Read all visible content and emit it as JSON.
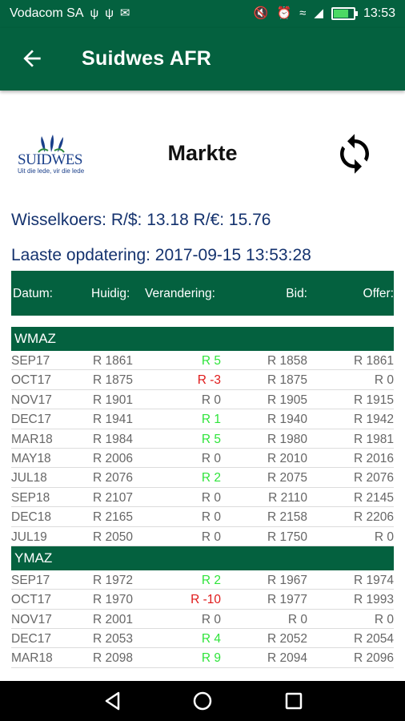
{
  "status_bar": {
    "carrier": "Vodacom SA",
    "time": "13:53",
    "battery_pct": 80
  },
  "app_bar": {
    "title": "Suidwes AFR"
  },
  "header": {
    "logo_text": "SUIDWES",
    "logo_tagline": "Uit die lede, vir die lede",
    "title": "Markte"
  },
  "exchange": "Wisselkoers: R/$: 13.18 R/€: 15.76",
  "last_update": "Laaste opdatering: 2017-09-15 13:53:28",
  "columns": {
    "date": "Datum:",
    "current": "Huidig:",
    "change": "Verandering:",
    "bid": "Bid:",
    "offer": "Offer:"
  },
  "sections": [
    {
      "name": "WMAZ",
      "rows": [
        {
          "date": "SEP17",
          "current": "R 1861",
          "change": "R 5",
          "trend": "pos",
          "bid": "R 1858",
          "offer": "R 1861"
        },
        {
          "date": "OCT17",
          "current": "R 1875",
          "change": "R -3",
          "trend": "neg",
          "bid": "R 1875",
          "offer": "R 0"
        },
        {
          "date": "NOV17",
          "current": "R 1901",
          "change": "R 0",
          "trend": "zero",
          "bid": "R 1905",
          "offer": "R 1915"
        },
        {
          "date": "DEC17",
          "current": "R 1941",
          "change": "R 1",
          "trend": "pos",
          "bid": "R 1940",
          "offer": "R 1942"
        },
        {
          "date": "MAR18",
          "current": "R 1984",
          "change": "R 5",
          "trend": "pos",
          "bid": "R 1980",
          "offer": "R 1981"
        },
        {
          "date": "MAY18",
          "current": "R 2006",
          "change": "R 0",
          "trend": "zero",
          "bid": "R 2010",
          "offer": "R 2016"
        },
        {
          "date": "JUL18",
          "current": "R 2076",
          "change": "R 2",
          "trend": "pos",
          "bid": "R 2075",
          "offer": "R 2076"
        },
        {
          "date": "SEP18",
          "current": "R 2107",
          "change": "R 0",
          "trend": "zero",
          "bid": "R 2110",
          "offer": "R 2145"
        },
        {
          "date": "DEC18",
          "current": "R 2165",
          "change": "R 0",
          "trend": "zero",
          "bid": "R 2158",
          "offer": "R 2206"
        },
        {
          "date": "JUL19",
          "current": "R 2050",
          "change": "R 0",
          "trend": "zero",
          "bid": "R 1750",
          "offer": "R 0"
        }
      ]
    },
    {
      "name": "YMAZ",
      "rows": [
        {
          "date": "SEP17",
          "current": "R 1972",
          "change": "R 2",
          "trend": "pos",
          "bid": "R 1967",
          "offer": "R 1974"
        },
        {
          "date": "OCT17",
          "current": "R 1970",
          "change": "R -10",
          "trend": "neg",
          "bid": "R 1977",
          "offer": "R 1993"
        },
        {
          "date": "NOV17",
          "current": "R 2001",
          "change": "R 0",
          "trend": "zero",
          "bid": "R 0",
          "offer": "R 0"
        },
        {
          "date": "DEC17",
          "current": "R 2053",
          "change": "R 4",
          "trend": "pos",
          "bid": "R 2052",
          "offer": "R 2054"
        },
        {
          "date": "MAR18",
          "current": "R 2098",
          "change": "R 9",
          "trend": "pos",
          "bid": "R 2094",
          "offer": "R 2096"
        }
      ]
    }
  ]
}
